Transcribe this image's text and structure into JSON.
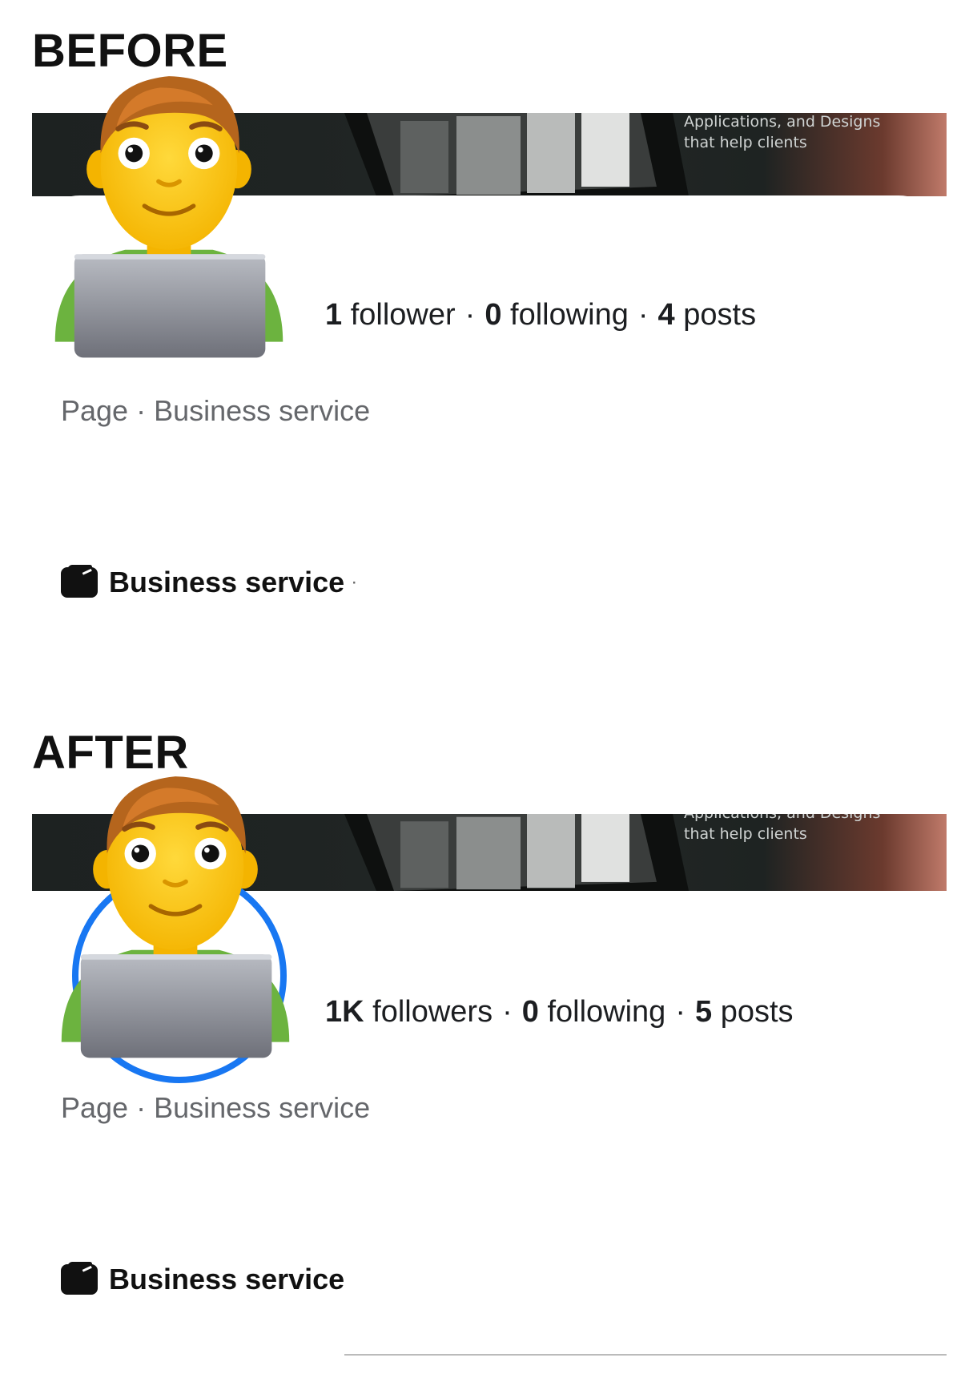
{
  "before": {
    "label": "BEFORE",
    "cover_text_line1": "Applications, and Designs",
    "cover_text_line2": "that help clients",
    "stats": {
      "followers_count": "1",
      "followers_label": "follower",
      "following_count": "0",
      "following_label": "following",
      "posts_count": "4",
      "posts_label": "posts",
      "separator": "·"
    },
    "category": "Page · Business service",
    "business_label": "Business service",
    "business_trailing": "·"
  },
  "after": {
    "label": "AFTER",
    "cover_text_line1": "Applications, and Designs",
    "cover_text_line2": "that help clients",
    "stats": {
      "followers_count": "1K",
      "followers_label": "followers",
      "following_count": "0",
      "following_label": "following",
      "posts_count": "5",
      "posts_label": "posts",
      "separator": "·"
    },
    "category": "Page · Business service",
    "business_label": "Business service"
  },
  "icons": {
    "avatar": "man-technologist-emoji",
    "business": "clapperboard-icon"
  },
  "colors": {
    "story_ring": "#1877f2",
    "muted_text": "#65676b",
    "cover_dark": "#1d2221"
  }
}
